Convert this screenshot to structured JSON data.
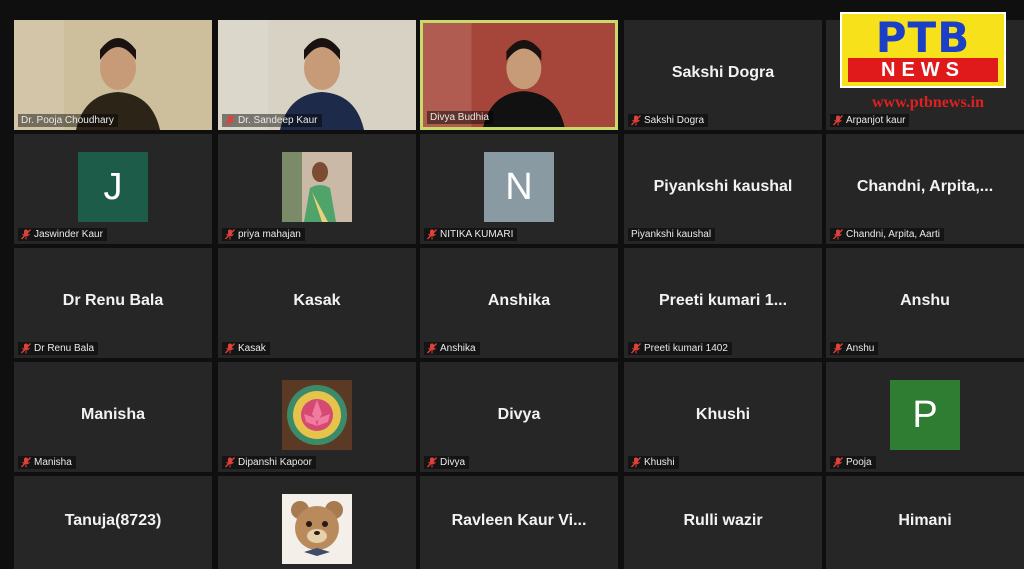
{
  "logo": {
    "text_top": "PTB",
    "text_bottom": "NEWS",
    "url": "www.ptbnews.in"
  },
  "tiles": [
    {
      "kind": "video",
      "label": "Dr. Pooja Choudhary",
      "muted": false,
      "bg": "#cdbf9c",
      "figure": "#2d2418"
    },
    {
      "kind": "video",
      "label": "Dr. Sandeep Kaur",
      "muted": true,
      "bg": "#d8d2c4",
      "figure": "#1d2a4a"
    },
    {
      "kind": "video",
      "label": "Divya Budhia",
      "muted": false,
      "active": true,
      "bg": "#a6463a",
      "figure": "#111111"
    },
    {
      "kind": "name",
      "center": "Sakshi Dogra",
      "label": "Sakshi Dogra",
      "muted": true
    },
    {
      "kind": "name",
      "center": "",
      "label": "Arpanjot kaur",
      "muted": true
    },
    {
      "kind": "avatar",
      "letter": "J",
      "color": "#1e5c4a",
      "label": "Jaswinder Kaur",
      "muted": true
    },
    {
      "kind": "photo",
      "photo": "saree",
      "label": "priya mahajan",
      "muted": true
    },
    {
      "kind": "avatar",
      "letter": "N",
      "color": "#8a9aa3",
      "label": "NITIKA KUMARI",
      "muted": true
    },
    {
      "kind": "name",
      "center": "Piyankshi kaushal",
      "label": "Piyankshi kaushal",
      "muted": false
    },
    {
      "kind": "name",
      "center": "Chandni,  Arpita,...",
      "label": "Chandni, Arpita, Aarti",
      "muted": true
    },
    {
      "kind": "name",
      "center": "Dr Renu Bala",
      "label": "Dr Renu Bala",
      "muted": true
    },
    {
      "kind": "name",
      "center": "Kasak",
      "label": "Kasak",
      "muted": true
    },
    {
      "kind": "name",
      "center": "Anshika",
      "label": "Anshika",
      "muted": true
    },
    {
      "kind": "name",
      "center": "Preeti kumari 1...",
      "label": "Preeti kumari 1402",
      "muted": true
    },
    {
      "kind": "name",
      "center": "Anshu",
      "label": "Anshu",
      "muted": true
    },
    {
      "kind": "name",
      "center": "Manisha",
      "label": "Manisha",
      "muted": true
    },
    {
      "kind": "photo",
      "photo": "lotus",
      "label": "Dipanshi Kapoor",
      "muted": true
    },
    {
      "kind": "name",
      "center": "Divya",
      "label": "Divya",
      "muted": true
    },
    {
      "kind": "name",
      "center": "Khushi",
      "label": "Khushi",
      "muted": true
    },
    {
      "kind": "avatar",
      "letter": "P",
      "color": "#2e7d32",
      "label": "Pooja",
      "muted": true
    },
    {
      "kind": "name",
      "center": "Tanuja(8723)",
      "label": "",
      "muted": false
    },
    {
      "kind": "photo",
      "photo": "teddy",
      "label": "",
      "muted": false
    },
    {
      "kind": "name",
      "center": "Ravleen  Kaur  Vi...",
      "label": "",
      "muted": false
    },
    {
      "kind": "name",
      "center": "Rulli wazir",
      "label": "",
      "muted": false
    },
    {
      "kind": "name",
      "center": "Himani",
      "label": "",
      "muted": false
    }
  ],
  "colors": {
    "active_border": "#c9d96c",
    "tile_bg": "#262626",
    "mute_icon": "#e0413a"
  }
}
